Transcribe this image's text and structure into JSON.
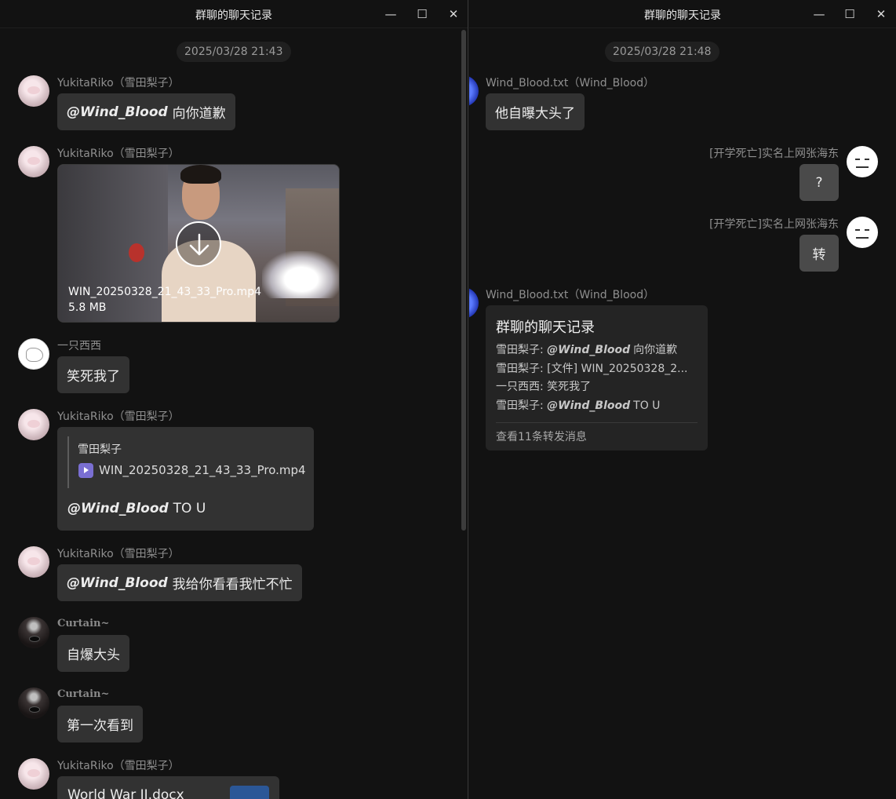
{
  "left_window": {
    "title": "群聊的聊天记录",
    "timestamp": "2025/03/28 21:43",
    "messages": [
      {
        "sender": "YukitaRiko（雪田梨子）",
        "mention": "@Wind_Blood",
        "text": "向你道歉"
      },
      {
        "sender": "YukitaRiko（雪田梨子）",
        "video": {
          "file_name": "WIN_20250328_21_43_33_Pro.mp4",
          "file_size": "5.8 MB"
        }
      },
      {
        "sender": "一只西西",
        "text": "笑死我了"
      },
      {
        "sender": "YukitaRiko（雪田梨子）",
        "quote": {
          "author": "雪田梨子",
          "file_name": "WIN_20250328_21_43_33_Pro.mp4"
        },
        "mention": "@Wind_Blood",
        "text": "TO U"
      },
      {
        "sender": "YukitaRiko（雪田梨子）",
        "mention": "@Wind_Blood",
        "text": "我给你看看我忙不忙"
      },
      {
        "sender": "Curtain~",
        "text": "自爆大头"
      },
      {
        "sender": "Curtain~",
        "text": "第一次看到"
      },
      {
        "sender": "YukitaRiko（雪田梨子）",
        "doc": {
          "file_name": "World War II.docx"
        }
      }
    ]
  },
  "right_window": {
    "title": "群聊的聊天记录",
    "timestamp": "2025/03/28 21:48",
    "messages": [
      {
        "sender": "Wind_Blood.txt（Wind_Blood）",
        "text": "他自曝大头了"
      },
      {
        "sender": "[开学死亡]实名上网张海东",
        "text": "?"
      },
      {
        "sender": "[开学死亡]实名上网张海东",
        "text": "转"
      },
      {
        "sender": "Wind_Blood.txt（Wind_Blood）",
        "forward": {
          "title": "群聊的聊天记录",
          "lines": [
            {
              "prefix": "雪田梨子: ",
              "mention": "@Wind_Blood",
              "text": "向你道歉"
            },
            {
              "prefix": "雪田梨子: ",
              "text": "[文件] WIN_20250328_2..."
            },
            {
              "prefix": "一只西西: ",
              "text": "笑死我了"
            },
            {
              "prefix": "雪田梨子: ",
              "mention": "@Wind_Blood",
              "text": "TO U"
            }
          ],
          "view_more": "查看11条转发消息"
        }
      }
    ]
  },
  "icons": {
    "minimize": "minimize-icon",
    "maximize": "maximize-icon",
    "close": "close-icon",
    "download": "download-icon",
    "video_file": "video-file-icon",
    "word_doc": "word-doc-icon"
  },
  "window_controls": {
    "minimize": "—",
    "maximize": "☐",
    "close": "✕"
  }
}
